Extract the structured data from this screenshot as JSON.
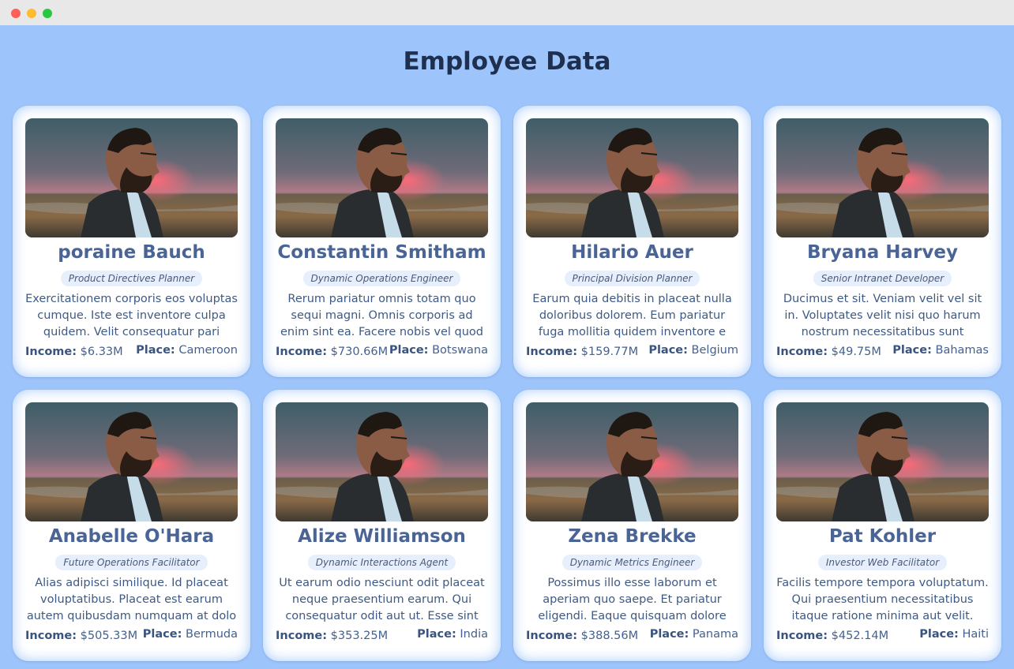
{
  "title": "Employee Data",
  "labels": {
    "income": "Income:",
    "place": "Place:"
  },
  "employees": [
    {
      "name": "poraine Bauch",
      "role": "Product Directives Planner",
      "description": "Exercitationem corporis eos voluptas cumque. Iste est inventore culpa quidem. Velit consequatur pari",
      "income": "$6.33M",
      "place": "Cameroon"
    },
    {
      "name": "Constantin Smitham",
      "role": "Dynamic Operations Engineer",
      "description": "Rerum pariatur omnis totam quo sequi magni. Omnis corporis ad enim sint ea. Facere nobis vel quod es",
      "income": "$730.66M",
      "place": "Botswana"
    },
    {
      "name": "Hilario Auer",
      "role": "Principal Division Planner",
      "description": "Earum quia debitis in placeat nulla doloribus dolorem. Eum pariatur fuga mollitia quidem inventore e",
      "income": "$159.77M",
      "place": "Belgium"
    },
    {
      "name": "Bryana Harvey",
      "role": "Senior Intranet Developer",
      "description": "Ducimus et sit. Veniam velit vel sit in. Voluptates velit nisi quo harum nostrum necessitatibus sunt",
      "income": "$49.75M",
      "place": "Bahamas"
    },
    {
      "name": "Anabelle O'Hara",
      "role": "Future Operations Facilitator",
      "description": "Alias adipisci similique. Id placeat voluptatibus. Placeat est earum autem quibusdam numquam at dolo",
      "income": "$505.33M",
      "place": "Bermuda"
    },
    {
      "name": "Alize Williamson",
      "role": "Dynamic Interactions Agent",
      "description": "Ut earum odio nesciunt odit placeat neque praesentium earum. Qui consequatur odit aut ut. Esse sint",
      "income": "$353.25M",
      "place": "India"
    },
    {
      "name": "Zena Brekke",
      "role": "Dynamic Metrics Engineer",
      "description": "Possimus illo esse laborum et aperiam quo saepe. Et pariatur eligendi. Eaque quisquam dolore explica",
      "income": "$388.56M",
      "place": "Panama"
    },
    {
      "name": "Pat Kohler",
      "role": "Investor Web Facilitator",
      "description": "Facilis tempore tempora voluptatum. Qui praesentium necessitatibus itaque ratione minima aut velit.",
      "income": "$452.14M",
      "place": "Haiti"
    }
  ]
}
